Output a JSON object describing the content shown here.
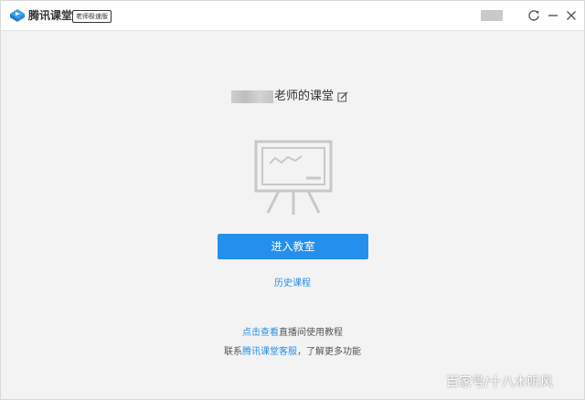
{
  "titlebar": {
    "app_name": "腾讯课堂",
    "edition_badge": "老师极速版"
  },
  "main": {
    "title_suffix": "老师的课堂",
    "enter_button": "进入教室",
    "history_link": "历史课程",
    "tutorial_link": "点击查看",
    "tutorial_text": "直播间使用教程",
    "support_prefix": "联系",
    "support_link": "腾讯课堂客服",
    "support_suffix": "，了解更多功能"
  },
  "watermark": "百家号/十八木听风",
  "colors": {
    "accent": "#2590ec",
    "background": "#f3f3f3",
    "titlebar": "#ffffff"
  },
  "icons": [
    "logo-icon",
    "refresh-icon",
    "minimize-icon",
    "close-icon",
    "edit-icon",
    "blackboard-icon"
  ]
}
